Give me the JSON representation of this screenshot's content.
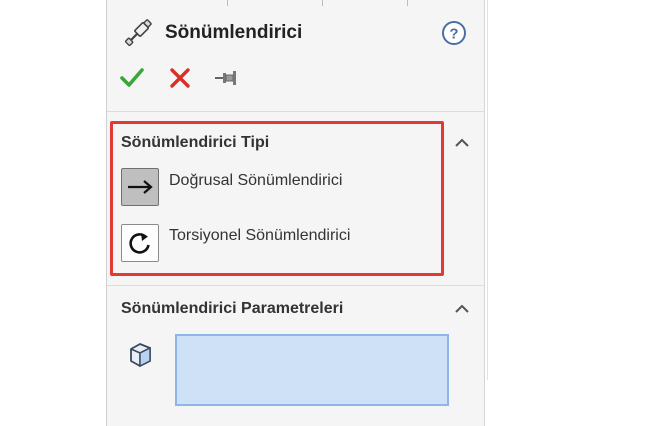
{
  "header": {
    "title": "Sönümlendirici",
    "title_icon": "damper-tool-icon",
    "help_icon": "help-icon"
  },
  "actions": {
    "ok_icon": "checkmark-icon",
    "cancel_icon": "close-icon",
    "pin_icon": "pushpin-icon",
    "ok_color": "#3aa53a",
    "cancel_color": "#d93025"
  },
  "damper_type": {
    "title": "Sönümlendirici Tipi",
    "options": [
      {
        "label": "Doğrusal Sönümlendirici",
        "icon": "arrow-right-icon",
        "selected": true
      },
      {
        "label": "Torsiyonel Sönümlendirici",
        "icon": "rotate-icon",
        "selected": false
      }
    ],
    "highlight_color": "#e23a33"
  },
  "damper_params": {
    "title": "Sönümlendirici Parametreleri",
    "selection_icon": "face-cube-icon",
    "selection_value": ""
  }
}
